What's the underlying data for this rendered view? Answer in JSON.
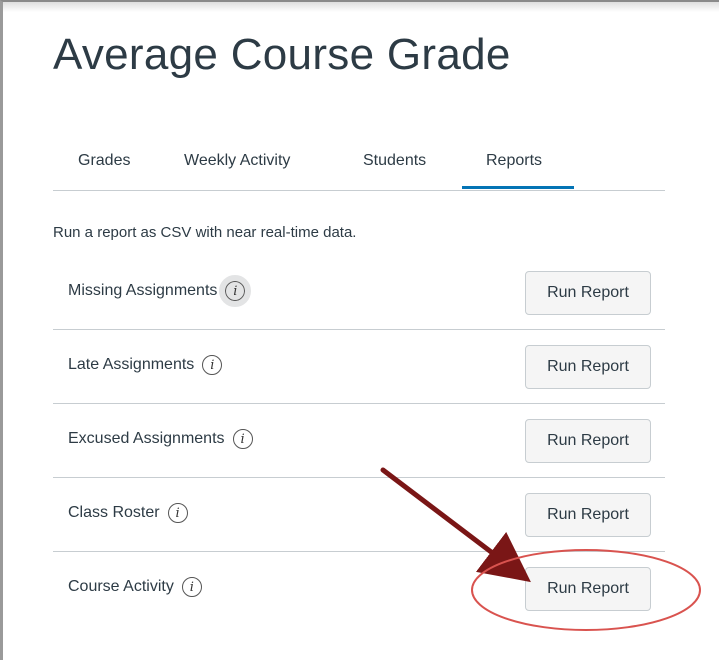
{
  "page": {
    "title": "Average Course Grade"
  },
  "tabs": [
    {
      "label": "Grades",
      "active": false
    },
    {
      "label": "Weekly Activity",
      "active": false
    },
    {
      "label": "Students",
      "active": false
    },
    {
      "label": "Reports",
      "active": true
    }
  ],
  "reports": {
    "description": "Run a report as CSV with near real-time data.",
    "info_glyph": "i",
    "items": [
      {
        "label": "Missing Assignments",
        "button": "Run Report"
      },
      {
        "label": "Late Assignments",
        "button": "Run Report"
      },
      {
        "label": "Excused Assignments",
        "button": "Run Report"
      },
      {
        "label": "Class Roster",
        "button": "Run Report"
      },
      {
        "label": "Course Activity",
        "button": "Run Report"
      }
    ]
  },
  "annotation": {
    "arrow_color": "#7a1616",
    "circle_color": "#d9534f"
  },
  "colors": {
    "accent": "#0374b5",
    "text": "#2d3b45",
    "divider": "#c7cdd1"
  }
}
